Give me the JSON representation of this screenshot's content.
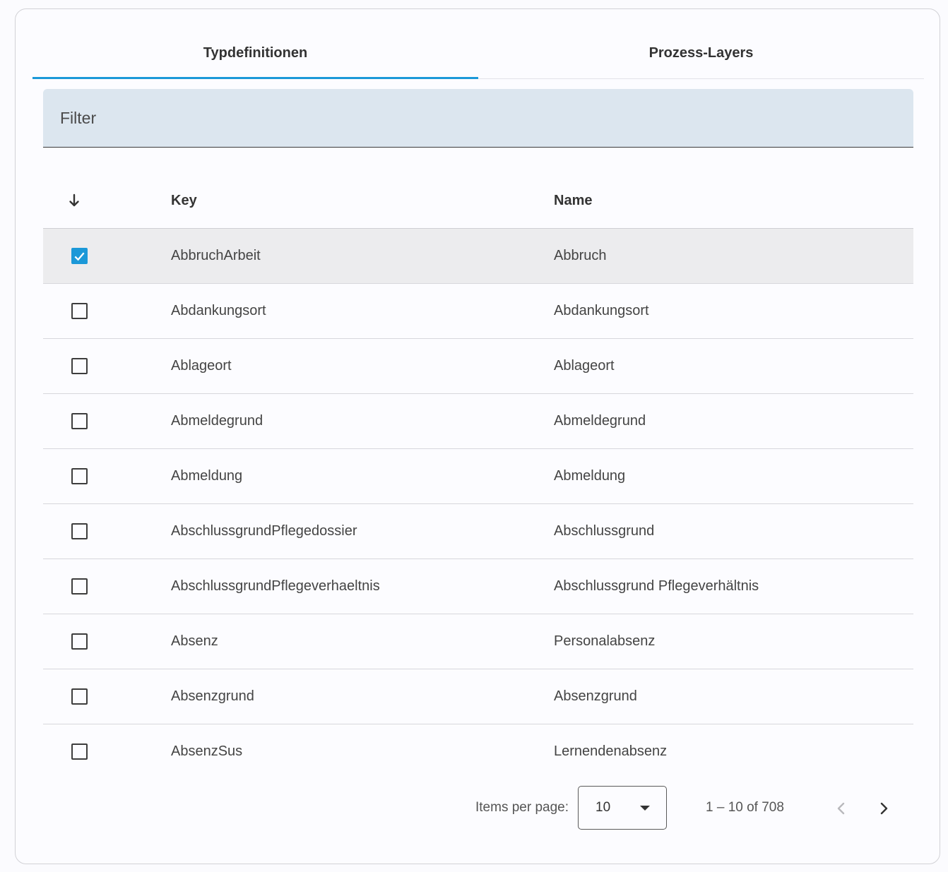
{
  "tabs": [
    {
      "label": "Typdefinitionen",
      "active": true
    },
    {
      "label": "Prozess-Layers",
      "active": false
    }
  ],
  "filter": {
    "label": "Filter"
  },
  "table": {
    "columns": {
      "key": "Key",
      "name": "Name"
    },
    "rows": [
      {
        "key": "AbbruchArbeit",
        "name": "Abbruch",
        "selected": true
      },
      {
        "key": "Abdankungsort",
        "name": "Abdankungsort",
        "selected": false
      },
      {
        "key": "Ablageort",
        "name": "Ablageort",
        "selected": false
      },
      {
        "key": "Abmeldegrund",
        "name": "Abmeldegrund",
        "selected": false
      },
      {
        "key": "Abmeldung",
        "name": "Abmeldung",
        "selected": false
      },
      {
        "key": "AbschlussgrundPflegedossier",
        "name": "Abschlussgrund",
        "selected": false
      },
      {
        "key": "AbschlussgrundPflegeverhaeltnis",
        "name": "Abschlussgrund Pflegeverhältnis",
        "selected": false
      },
      {
        "key": "Absenz",
        "name": "Personalabsenz",
        "selected": false
      },
      {
        "key": "Absenzgrund",
        "name": "Absenzgrund",
        "selected": false
      },
      {
        "key": "AbsenzSus",
        "name": "Lernendenabsenz",
        "selected": false
      }
    ]
  },
  "paginator": {
    "items_per_page_label": "Items per page:",
    "page_size": "10",
    "range_label": "1 – 10 of 708"
  },
  "colors": {
    "accent": "#1b98d8",
    "filter_bg": "#dce6ef",
    "selected_row": "#ececee"
  },
  "icons": {
    "sort": "arrow-down-icon",
    "check": "check-icon",
    "prev": "chevron-left-icon",
    "next": "chevron-right-icon",
    "dropdown": "caret-down-icon"
  }
}
